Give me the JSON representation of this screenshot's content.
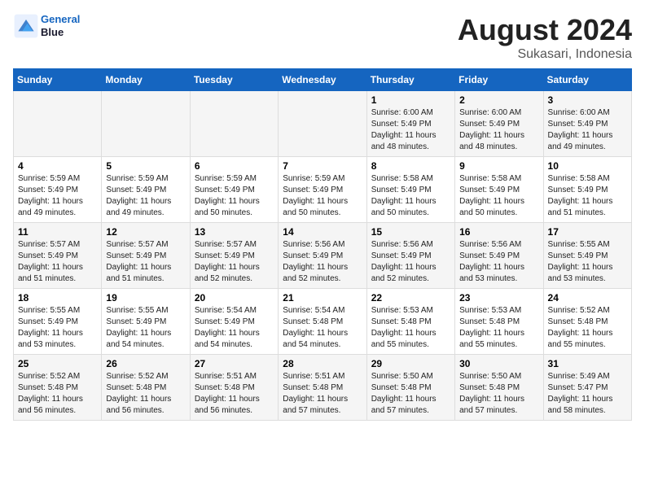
{
  "header": {
    "logo_line1": "General",
    "logo_line2": "Blue",
    "title": "August 2024",
    "subtitle": "Sukasari, Indonesia"
  },
  "weekdays": [
    "Sunday",
    "Monday",
    "Tuesday",
    "Wednesday",
    "Thursday",
    "Friday",
    "Saturday"
  ],
  "weeks": [
    [
      {
        "day": "",
        "info": ""
      },
      {
        "day": "",
        "info": ""
      },
      {
        "day": "",
        "info": ""
      },
      {
        "day": "",
        "info": ""
      },
      {
        "day": "1",
        "info": "Sunrise: 6:00 AM\nSunset: 5:49 PM\nDaylight: 11 hours\nand 48 minutes."
      },
      {
        "day": "2",
        "info": "Sunrise: 6:00 AM\nSunset: 5:49 PM\nDaylight: 11 hours\nand 48 minutes."
      },
      {
        "day": "3",
        "info": "Sunrise: 6:00 AM\nSunset: 5:49 PM\nDaylight: 11 hours\nand 49 minutes."
      }
    ],
    [
      {
        "day": "4",
        "info": "Sunrise: 5:59 AM\nSunset: 5:49 PM\nDaylight: 11 hours\nand 49 minutes."
      },
      {
        "day": "5",
        "info": "Sunrise: 5:59 AM\nSunset: 5:49 PM\nDaylight: 11 hours\nand 49 minutes."
      },
      {
        "day": "6",
        "info": "Sunrise: 5:59 AM\nSunset: 5:49 PM\nDaylight: 11 hours\nand 50 minutes."
      },
      {
        "day": "7",
        "info": "Sunrise: 5:59 AM\nSunset: 5:49 PM\nDaylight: 11 hours\nand 50 minutes."
      },
      {
        "day": "8",
        "info": "Sunrise: 5:58 AM\nSunset: 5:49 PM\nDaylight: 11 hours\nand 50 minutes."
      },
      {
        "day": "9",
        "info": "Sunrise: 5:58 AM\nSunset: 5:49 PM\nDaylight: 11 hours\nand 50 minutes."
      },
      {
        "day": "10",
        "info": "Sunrise: 5:58 AM\nSunset: 5:49 PM\nDaylight: 11 hours\nand 51 minutes."
      }
    ],
    [
      {
        "day": "11",
        "info": "Sunrise: 5:57 AM\nSunset: 5:49 PM\nDaylight: 11 hours\nand 51 minutes."
      },
      {
        "day": "12",
        "info": "Sunrise: 5:57 AM\nSunset: 5:49 PM\nDaylight: 11 hours\nand 51 minutes."
      },
      {
        "day": "13",
        "info": "Sunrise: 5:57 AM\nSunset: 5:49 PM\nDaylight: 11 hours\nand 52 minutes."
      },
      {
        "day": "14",
        "info": "Sunrise: 5:56 AM\nSunset: 5:49 PM\nDaylight: 11 hours\nand 52 minutes."
      },
      {
        "day": "15",
        "info": "Sunrise: 5:56 AM\nSunset: 5:49 PM\nDaylight: 11 hours\nand 52 minutes."
      },
      {
        "day": "16",
        "info": "Sunrise: 5:56 AM\nSunset: 5:49 PM\nDaylight: 11 hours\nand 53 minutes."
      },
      {
        "day": "17",
        "info": "Sunrise: 5:55 AM\nSunset: 5:49 PM\nDaylight: 11 hours\nand 53 minutes."
      }
    ],
    [
      {
        "day": "18",
        "info": "Sunrise: 5:55 AM\nSunset: 5:49 PM\nDaylight: 11 hours\nand 53 minutes."
      },
      {
        "day": "19",
        "info": "Sunrise: 5:55 AM\nSunset: 5:49 PM\nDaylight: 11 hours\nand 54 minutes."
      },
      {
        "day": "20",
        "info": "Sunrise: 5:54 AM\nSunset: 5:49 PM\nDaylight: 11 hours\nand 54 minutes."
      },
      {
        "day": "21",
        "info": "Sunrise: 5:54 AM\nSunset: 5:48 PM\nDaylight: 11 hours\nand 54 minutes."
      },
      {
        "day": "22",
        "info": "Sunrise: 5:53 AM\nSunset: 5:48 PM\nDaylight: 11 hours\nand 55 minutes."
      },
      {
        "day": "23",
        "info": "Sunrise: 5:53 AM\nSunset: 5:48 PM\nDaylight: 11 hours\nand 55 minutes."
      },
      {
        "day": "24",
        "info": "Sunrise: 5:52 AM\nSunset: 5:48 PM\nDaylight: 11 hours\nand 55 minutes."
      }
    ],
    [
      {
        "day": "25",
        "info": "Sunrise: 5:52 AM\nSunset: 5:48 PM\nDaylight: 11 hours\nand 56 minutes."
      },
      {
        "day": "26",
        "info": "Sunrise: 5:52 AM\nSunset: 5:48 PM\nDaylight: 11 hours\nand 56 minutes."
      },
      {
        "day": "27",
        "info": "Sunrise: 5:51 AM\nSunset: 5:48 PM\nDaylight: 11 hours\nand 56 minutes."
      },
      {
        "day": "28",
        "info": "Sunrise: 5:51 AM\nSunset: 5:48 PM\nDaylight: 11 hours\nand 57 minutes."
      },
      {
        "day": "29",
        "info": "Sunrise: 5:50 AM\nSunset: 5:48 PM\nDaylight: 11 hours\nand 57 minutes."
      },
      {
        "day": "30",
        "info": "Sunrise: 5:50 AM\nSunset: 5:48 PM\nDaylight: 11 hours\nand 57 minutes."
      },
      {
        "day": "31",
        "info": "Sunrise: 5:49 AM\nSunset: 5:47 PM\nDaylight: 11 hours\nand 58 minutes."
      }
    ]
  ]
}
